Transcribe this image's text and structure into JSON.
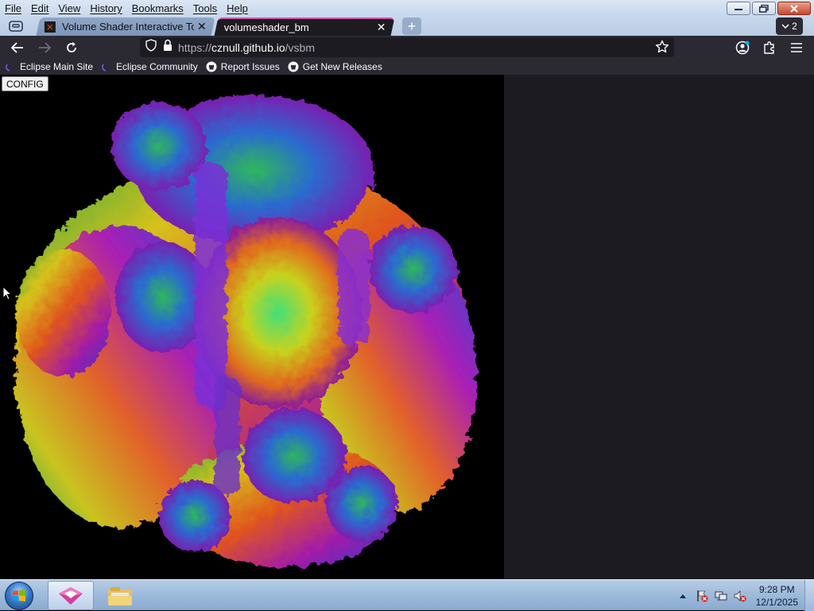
{
  "menu": {
    "items": [
      "File",
      "Edit",
      "View",
      "History",
      "Bookmarks",
      "Tools",
      "Help"
    ]
  },
  "tabs": [
    {
      "title": "Volume Shader Interactive Tool",
      "active": false,
      "icon": "volume-shader-favicon"
    },
    {
      "title": "volumeshader_bm",
      "active": true,
      "icon": "none"
    }
  ],
  "tab_count": "2",
  "urlbar": {
    "url_prefix": "https://",
    "url_host": "cznull.github.io",
    "url_path": "/vsbm"
  },
  "bookmarks": [
    {
      "label": "Eclipse Main Site",
      "icon": "eclipse-icon"
    },
    {
      "label": "Eclipse Community",
      "icon": "eclipse-icon"
    },
    {
      "label": "Report Issues",
      "icon": "github-icon"
    },
    {
      "label": "Get New Releases",
      "icon": "github-icon"
    }
  ],
  "page": {
    "config_label": "CONFIG"
  },
  "taskbar": {
    "clock_time": "9:28 PM",
    "clock_date": "12/1/2025"
  },
  "colors": {
    "toolbar_bg": "#2b2a33",
    "urlbar_bg": "#1c1b22",
    "active_tab_accent": "#d257a8",
    "canvas_bg": "#000000"
  }
}
